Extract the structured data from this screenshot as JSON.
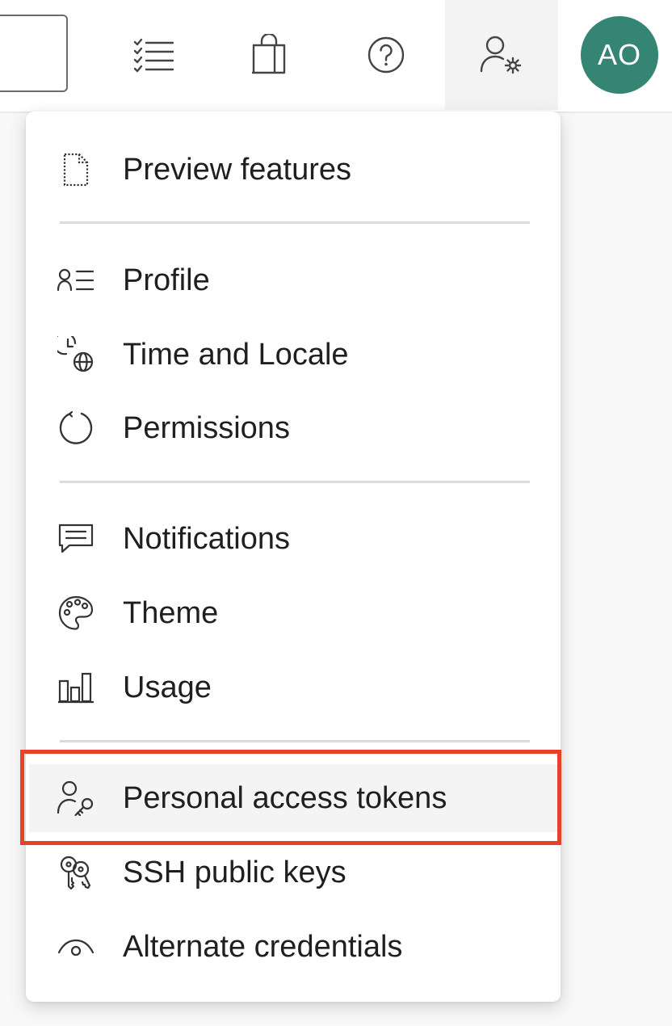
{
  "header": {
    "avatar_initials": "AO",
    "avatar_color": "#358574",
    "icons": [
      "search-box",
      "work-items-icon",
      "marketplace-bag-icon",
      "help-icon",
      "user-settings-icon"
    ]
  },
  "menu": {
    "items": [
      {
        "label": "Preview features",
        "icon": "preview-features-icon"
      },
      {
        "label": "Profile",
        "icon": "profile-icon"
      },
      {
        "label": "Time and Locale",
        "icon": "time-locale-icon"
      },
      {
        "label": "Permissions",
        "icon": "permissions-icon"
      },
      {
        "label": "Notifications",
        "icon": "notifications-icon"
      },
      {
        "label": "Theme",
        "icon": "theme-palette-icon"
      },
      {
        "label": "Usage",
        "icon": "usage-icon"
      },
      {
        "label": "Personal access tokens",
        "icon": "personal-access-tokens-icon",
        "selected": true
      },
      {
        "label": "SSH public keys",
        "icon": "ssh-keys-icon"
      },
      {
        "label": "Alternate credentials",
        "icon": "alternate-credentials-icon"
      }
    ]
  },
  "highlight_color": "#e8412a"
}
